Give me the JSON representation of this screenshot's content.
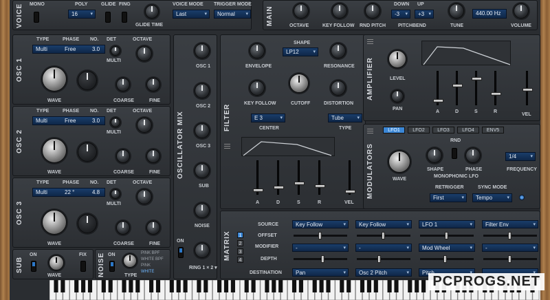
{
  "voice": {
    "title": "VOICE",
    "mono": "MONO",
    "poly": "POLY",
    "poly_value": "16",
    "glide": "GLIDE",
    "fing": "FING",
    "glide_time": "GLIDE TIME",
    "voice_mode": "VOICE MODE",
    "voice_mode_value": "Last",
    "trigger_mode": "TRIGGER MODE",
    "trigger_mode_value": "Normal"
  },
  "main": {
    "title": "MAIN",
    "octave": "OCTAVE",
    "key_follow": "KEY FOLLOW",
    "rnd_pitch": "RND PITCH",
    "pitchbend": "PITCHBEND",
    "down": "DOWN",
    "up": "UP",
    "down_value": "-3",
    "up_value": "+3",
    "tune": "TUNE",
    "tune_value": "440.00 Hz",
    "volume": "VOLUME"
  },
  "osc": [
    {
      "title": "OSC 1",
      "type": "TYPE",
      "phase": "PHASE",
      "no": "NO.",
      "det": "DET",
      "octave": "OCTAVE",
      "type_value": "Multi",
      "phase_value": "Free",
      "no_value": "3.0",
      "multi": "MULTI",
      "wave": "WAVE",
      "coarse": "COARSE",
      "fine": "FINE"
    },
    {
      "title": "OSC 2",
      "type": "TYPE",
      "phase": "PHASE",
      "no": "NO.",
      "det": "DET",
      "octave": "OCTAVE",
      "type_value": "Multi",
      "phase_value": "Free",
      "no_value": "3.0",
      "multi": "MULTI",
      "wave": "WAVE",
      "coarse": "COARSE",
      "fine": "FINE"
    },
    {
      "title": "OSC 3",
      "type": "TYPE",
      "phase": "PHASE",
      "no": "NO.",
      "det": "DET",
      "octave": "OCTAVE",
      "type_value": "Multi",
      "phase_value": "22 °",
      "no_value": "4.8",
      "multi": "MULTI",
      "wave": "WAVE",
      "coarse": "COARSE",
      "fine": "FINE"
    }
  ],
  "sub": {
    "title": "SUB",
    "on": "ON",
    "fix": "FIX",
    "wave": "WAVE"
  },
  "noise": {
    "title": "NOISE",
    "on": "ON",
    "type": "TYPE",
    "types": [
      "PINK BPF",
      "WHITE BPF",
      "PINK",
      "WHITE"
    ],
    "selected": "WHITE"
  },
  "oscmix": {
    "title": "OSCILLATOR MIX",
    "labels": [
      "OSC 1",
      "OSC 2",
      "OSC 3",
      "SUB",
      "NOISE"
    ],
    "on": "ON",
    "ring": "RING 1 × 2 ▾"
  },
  "filter": {
    "title": "FILTER",
    "shape": "SHAPE",
    "shape_value": "LP12",
    "envelope": "ENVELOPE",
    "resonance": "RESONANCE",
    "key_follow": "KEY FOLLOW",
    "cutoff": "CUTOFF",
    "distortion": "DISTORTION",
    "center": "CENTER",
    "center_value": "E 3",
    "type": "TYPE",
    "type_value": "Tube",
    "adsr": [
      "A",
      "D",
      "S",
      "R"
    ],
    "vel": "VEL"
  },
  "amplifier": {
    "title": "AMPLIFIER",
    "level": "LEVEL",
    "pan": "PAN",
    "adsr": [
      "A",
      "D",
      "S",
      "R"
    ],
    "vel": "VEL"
  },
  "modulators": {
    "title": "MODULATORS",
    "tabs": [
      "LFO1",
      "LFO2",
      "LFO3",
      "LFO4",
      "ENV5"
    ],
    "wave": "WAVE",
    "rnd": "RND",
    "shape": "SHAPE",
    "phase": "PHASE",
    "mono_lfo": "MONOPHONIC LFO",
    "frequency": "FREQUENCY",
    "frequency_value": "1/4",
    "retrigger": "RETRIGGER",
    "retrigger_value": "First",
    "sync_mode": "SYNC MODE",
    "sync_mode_value": "Tempo"
  },
  "matrix": {
    "title": "MATRIX",
    "rows": [
      "SOURCE",
      "OFFSET",
      "MODIFIER",
      "DEPTH",
      "DESTINATION"
    ],
    "nums": [
      "1",
      "2",
      "3",
      "4"
    ],
    "sources": [
      "Key Follow",
      "Key Follow",
      "LFO 1",
      "Filter Env"
    ],
    "modifiers": [
      "-",
      "-",
      "Mod Wheel",
      "-"
    ],
    "destinations": [
      "Pan",
      "Osc 2 Pitch",
      "Pitch",
      ""
    ]
  },
  "watermark": "PCPROGS.NET",
  "colors": {
    "accent": "#3b87d6",
    "panel": "#2c2f33"
  }
}
